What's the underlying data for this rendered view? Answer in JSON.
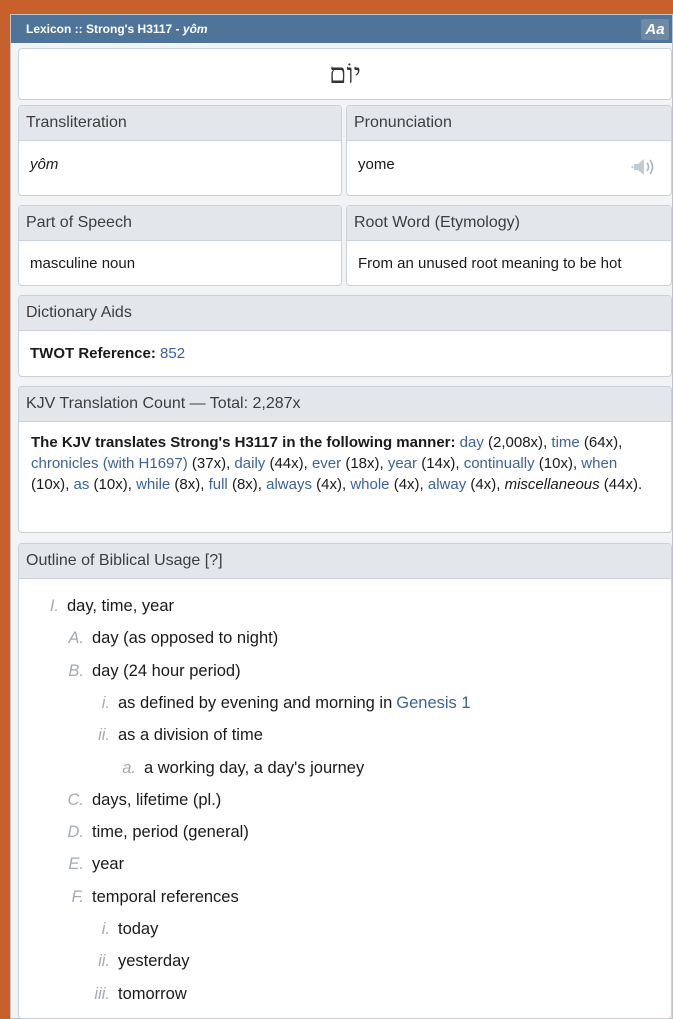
{
  "window": {
    "title_prefix": "Lexicon :: Strong's H3117 - ",
    "title_word": "yôm",
    "font_button": "Aa"
  },
  "hebrew": "יוֹם",
  "transliteration": {
    "label": "Transliteration",
    "value": "yôm"
  },
  "pronunciation": {
    "label": "Pronunciation",
    "value": "yome",
    "icon": "speaker-icon"
  },
  "part_of_speech": {
    "label": "Part of Speech",
    "value": "masculine noun"
  },
  "root_word": {
    "label": "Root Word (Etymology)",
    "value": "From an unused root meaning to be hot"
  },
  "dictionary_aids": {
    "label": "Dictionary Aids",
    "twot_label": "TWOT Reference:",
    "twot_value": "852"
  },
  "kjv": {
    "label": "KJV Translation Count — Total: 2,287x",
    "intro": "The KJV translates Strong's H3117 in the following manner:",
    "items": [
      {
        "word": "day",
        "count": "(2,008x)",
        "sep": ", "
      },
      {
        "word": "time",
        "count": "(64x)",
        "sep": ", "
      },
      {
        "word": "chronicles (with H1697)",
        "count": "(37x)",
        "sep": ", "
      },
      {
        "word": "daily",
        "count": "(44x)",
        "sep": ", "
      },
      {
        "word": "ever",
        "count": "(18x)",
        "sep": ", "
      },
      {
        "word": "year",
        "count": "(14x)",
        "sep": ", "
      },
      {
        "word": "continually",
        "count": "(10x)",
        "sep": ", "
      },
      {
        "word": "when",
        "count": "(10x)",
        "sep": ", "
      },
      {
        "word": "as",
        "count": "(10x)",
        "sep": ", "
      },
      {
        "word": "while",
        "count": "(8x)",
        "sep": ", "
      },
      {
        "word": "full",
        "count": "(8x)",
        "sep": ", "
      },
      {
        "word": "always",
        "count": "(4x)",
        "sep": ", "
      },
      {
        "word": "whole",
        "count": "(4x)",
        "sep": ", "
      },
      {
        "word": "alway",
        "count": "(4x)",
        "sep": ", "
      }
    ],
    "misc_word": "miscellaneous",
    "misc_count": "(44x)."
  },
  "outline": {
    "label": "Outline of Biblical Usage [?]",
    "rows": [
      {
        "mark": "I.",
        "text": "day, time, year",
        "level": 0
      },
      {
        "mark": "A.",
        "text": "day (as opposed to night)",
        "level": 1
      },
      {
        "mark": "B.",
        "text": "day (24 hour period)",
        "level": 1
      },
      {
        "mark": "i.",
        "text": "as defined by evening and morning in ",
        "link": "Genesis 1",
        "level": 2
      },
      {
        "mark": "ii.",
        "text": "as a division of time",
        "level": 2
      },
      {
        "mark": "a.",
        "text": "a working day, a day's journey",
        "level": 3
      },
      {
        "mark": "C.",
        "text": "days, lifetime (pl.)",
        "level": 1
      },
      {
        "mark": "D.",
        "text": "time, period (general)",
        "level": 1
      },
      {
        "mark": "E.",
        "text": "year",
        "level": 1
      },
      {
        "mark": "F.",
        "text": "temporal references",
        "level": 1
      },
      {
        "mark": "i.",
        "text": "today",
        "level": 2
      },
      {
        "mark": "ii.",
        "text": "yesterday",
        "level": 2
      },
      {
        "mark": "iii.",
        "text": "tomorrow",
        "level": 2
      }
    ]
  }
}
